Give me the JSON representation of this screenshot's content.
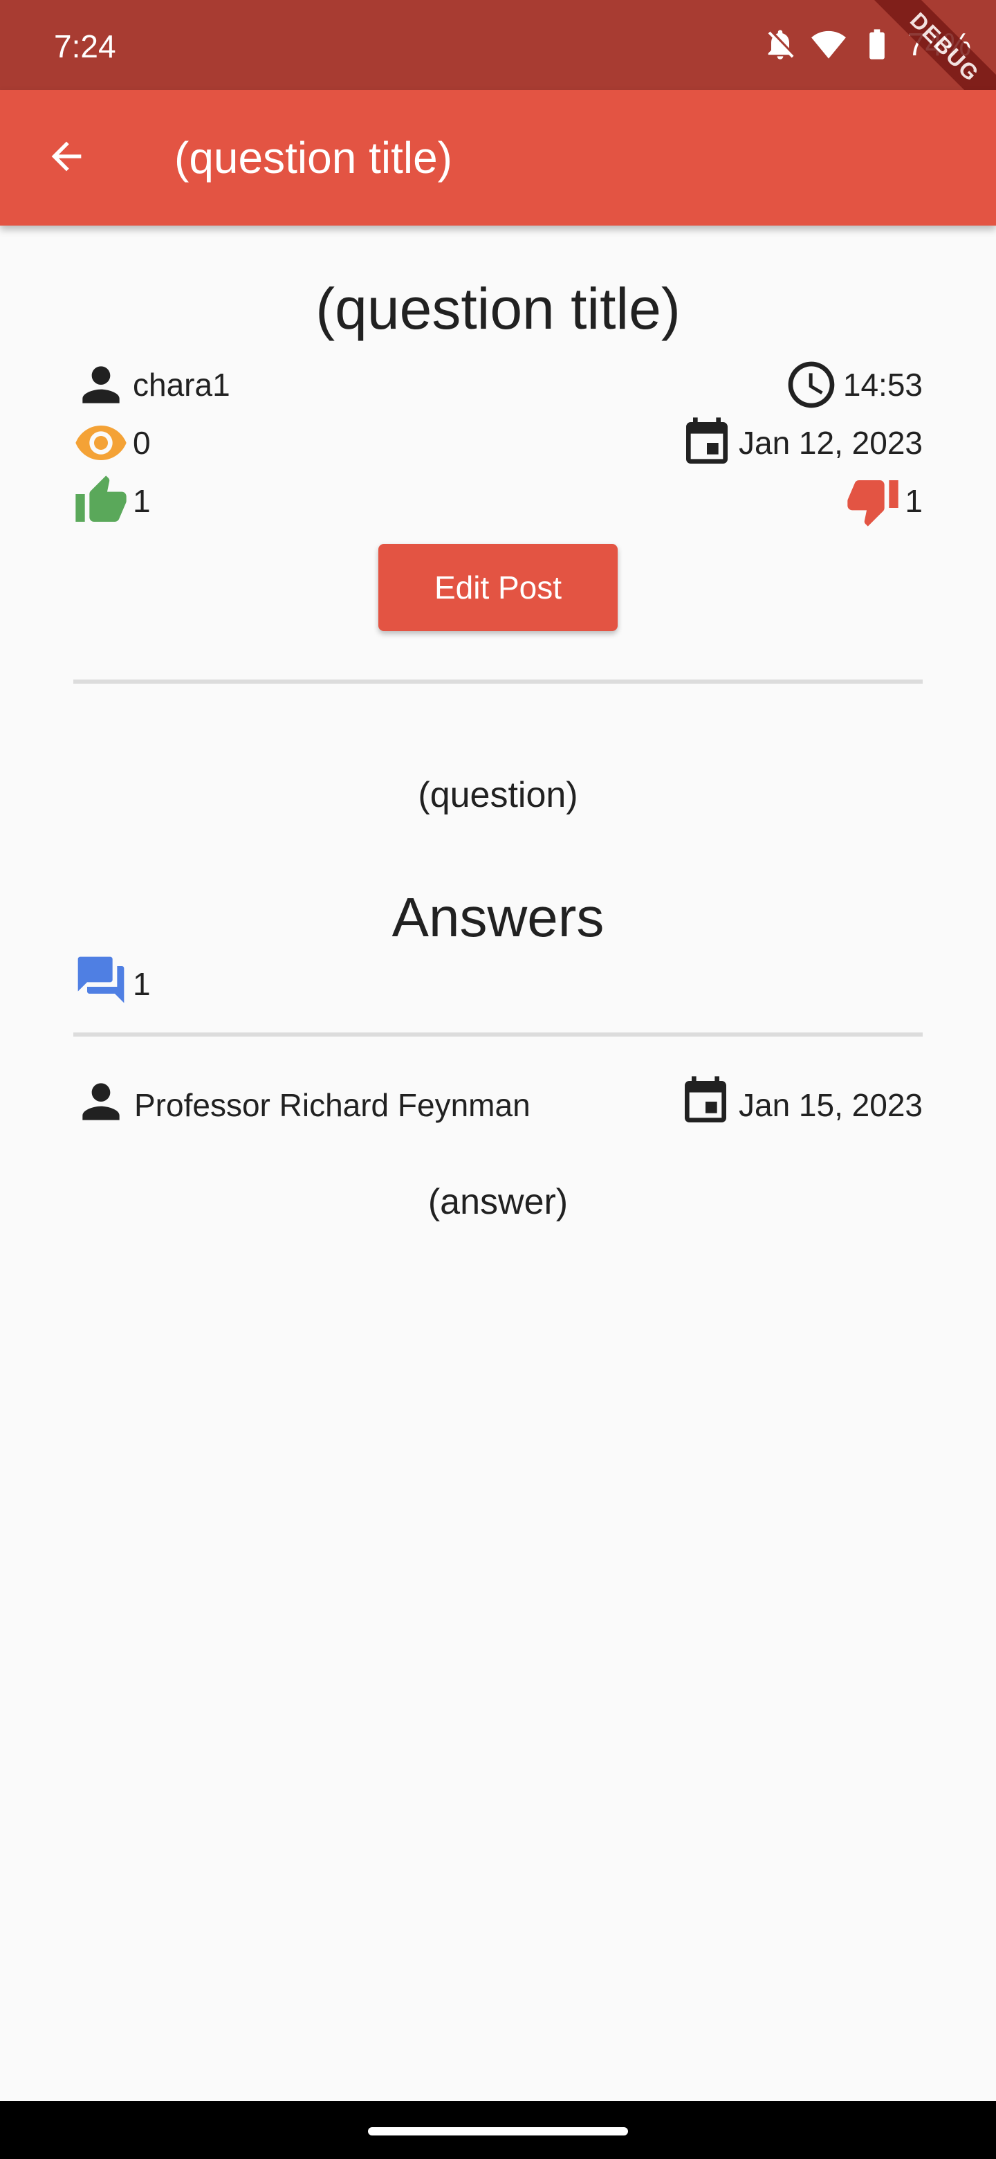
{
  "status_bar": {
    "time": "7:24",
    "battery": "74%",
    "debug_label": "DEBUG",
    "icons": [
      "bell-off-icon",
      "wifi-icon",
      "battery-icon"
    ]
  },
  "app_bar": {
    "title": "(question title)",
    "back_icon": "arrow-back-icon",
    "color": "#e35443"
  },
  "post": {
    "title": "(question title)",
    "author": "chara1",
    "time": "14:53",
    "views": "0",
    "date": "Jan 12, 2023",
    "likes": "1",
    "dislikes": "1",
    "edit_button_label": "Edit Post",
    "body": "(question)"
  },
  "answers": {
    "heading": "Answers",
    "count": "1",
    "items": [
      {
        "author": "Professor Richard Feynman",
        "date": "Jan 15, 2023",
        "body": "(answer)"
      }
    ]
  },
  "colors": {
    "status_bar": "#a83c32",
    "accent": "#e35443",
    "views_icon": "#f4a236",
    "like_icon": "#5aa85a",
    "dislike_icon": "#e35443",
    "answers_icon": "#4f7fe3"
  }
}
